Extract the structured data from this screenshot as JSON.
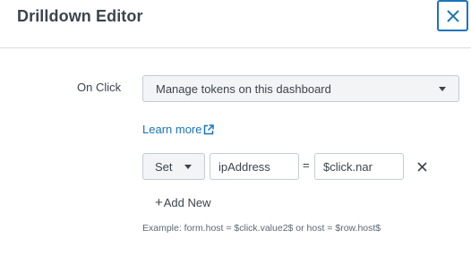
{
  "dialog": {
    "title": "Drilldown Editor",
    "close_icon": "close-icon"
  },
  "on_click": {
    "label": "On Click",
    "selected_option": "Manage tokens on this dashboard"
  },
  "learn_more": {
    "label": "Learn more",
    "icon": "external-link-icon"
  },
  "token_row": {
    "action_label": "Set",
    "token_name": "ipAddress",
    "equals": "=",
    "token_value": "$click.nar",
    "remove_icon": "remove-icon"
  },
  "add_new": {
    "plus": "+",
    "label": "Add New"
  },
  "example_text": "Example: form.host = $click.value2$ or host = $row.host$",
  "colors": {
    "accent": "#1a75b8",
    "text": "#3c444d",
    "border": "#c3cbd4",
    "control_bg": "#f2f4f5"
  }
}
